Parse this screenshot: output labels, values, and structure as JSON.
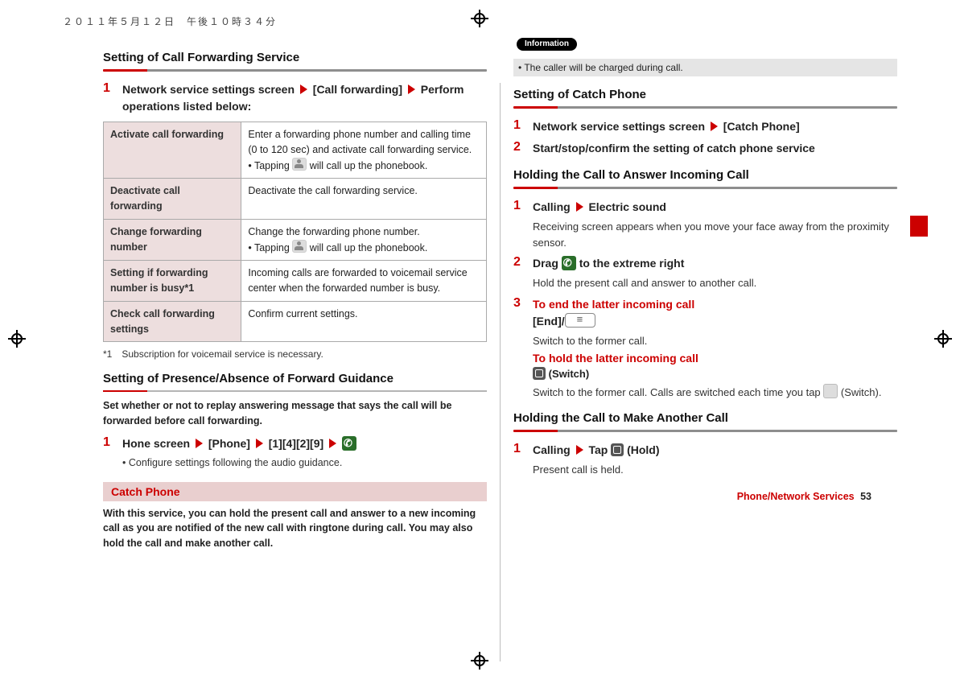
{
  "timestamp": "２０１１年５月１２日　午後１０時３４分",
  "left": {
    "heading1": "Setting of Call Forwarding Service",
    "step1": {
      "a": "Network service settings screen",
      "b": "[Call forwarding]",
      "c": "Perform operations listed below:"
    },
    "table": [
      {
        "key": "Activate call forwarding",
        "desc1": "Enter a forwarding phone number and calling time (0 to 120 sec) and activate call forwarding service.",
        "desc2": "Tapping ",
        "desc3": " will call up the phonebook."
      },
      {
        "key": "Deactivate call forwarding",
        "desc1": "Deactivate the call forwarding service."
      },
      {
        "key": "Change forwarding number",
        "desc1": "Change the forwarding phone number.",
        "desc2": "Tapping ",
        "desc3": " will call up the phonebook."
      },
      {
        "key": "Setting if forwarding number is busy*1",
        "desc1": "Incoming calls are forwarded to voicemail service center when the forwarded number is busy."
      },
      {
        "key": "Check call forwarding settings",
        "desc1": "Confirm current settings."
      }
    ],
    "footnote": "*1　Subscription for voicemail service is necessary.",
    "heading2": "Setting of Presence/Absence of Forward Guidance",
    "intro2": "Set whether or not to replay answering message that says the call will be forwarded before call forwarding.",
    "step2": {
      "a": "Hone screen",
      "b": "[Phone]",
      "c": "[1][4][2][9]"
    },
    "step2note": "Configure settings following the audio guidance.",
    "band": "Catch Phone",
    "bandIntro": "With this service, you can hold the present call and answer to a new incoming call as you are notified of the new call with ringtone during call. You may also hold the call and make another call."
  },
  "right": {
    "infoLabel": "Information",
    "infoText": "The caller will be charged during call.",
    "heading1": "Setting of Catch Phone",
    "step1": {
      "a": "Network service settings screen",
      "b": "[Catch Phone]"
    },
    "step2": "Start/stop/confirm the setting of catch phone service",
    "heading2": "Holding the Call to Answer Incoming Call",
    "h2s1": {
      "a": "Calling",
      "b": "Electric sound",
      "sub": "Receiving screen appears when you move your face away from the proximity sensor."
    },
    "h2s2": {
      "a": "Drag",
      "b": "to the extreme right",
      "sub": "Hold the present call and answer to another call."
    },
    "h2s3": {
      "red1": "To end the latter incoming call",
      "line": "[End]/",
      "sub1": "Switch to the former call.",
      "red2": "To hold the latter incoming call",
      "switch": "(Switch)",
      "sub2a": "Switch to the former call. Calls are switched each time you tap ",
      "sub2b": " (Switch)."
    },
    "heading3": "Holding the Call to Make Another Call",
    "h3s1": {
      "a": "Calling",
      "b": "Tap",
      "c": "(Hold)",
      "sub": "Present call is held."
    }
  },
  "footer": {
    "section": "Phone/Network Services",
    "page": "53"
  }
}
